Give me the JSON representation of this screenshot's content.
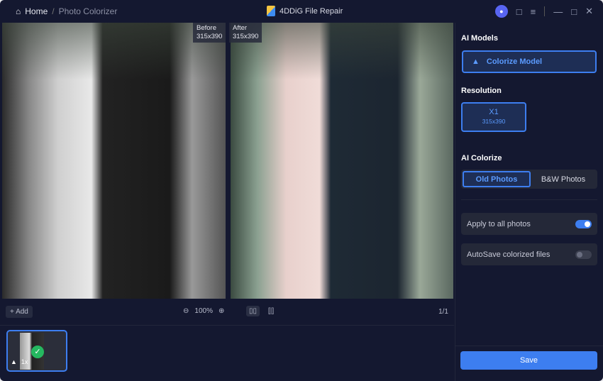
{
  "breadcrumb": {
    "home": "Home",
    "separator": "/",
    "current": "Photo Colorizer"
  },
  "app": {
    "title": "4DDiG File Repair"
  },
  "preview": {
    "before_label": "Before",
    "before_size": "315x390",
    "after_label": "After",
    "after_size": "315x390"
  },
  "toolbar": {
    "add_label": "+ Add",
    "zoom": "100%",
    "page": "1/1"
  },
  "thumbnail": {
    "scale": "1x"
  },
  "side": {
    "ai_models_title": "AI Models",
    "model_label": "Colorize Model",
    "resolution_title": "Resolution",
    "res_scale": "X1",
    "res_size": "315x390",
    "colorize_title": "AI Colorize",
    "options": [
      "Old Photos",
      "B&W Photos"
    ],
    "apply_all_label": "Apply to all photos",
    "apply_all": true,
    "autosave_label": "AutoSave colorized files",
    "autosave": false,
    "save_label": "Save"
  }
}
